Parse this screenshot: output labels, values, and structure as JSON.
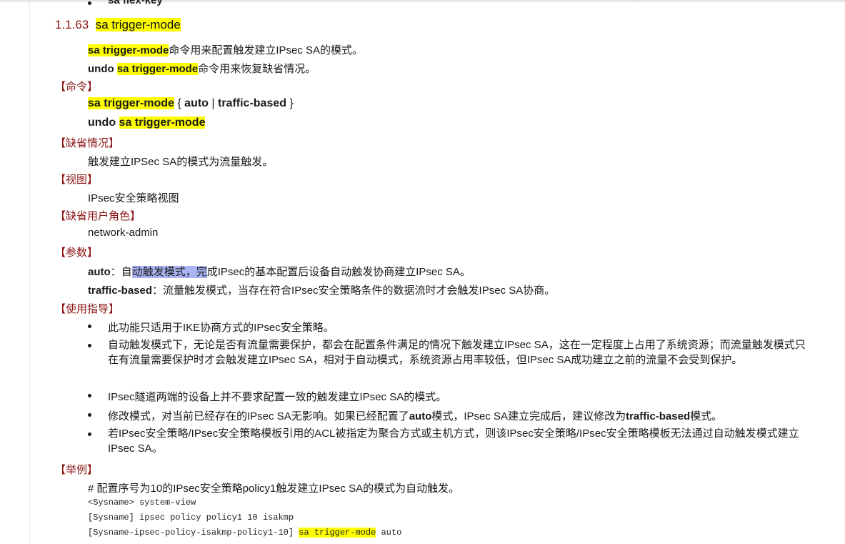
{
  "prev_item": {
    "label": "sa flex-key"
  },
  "heading": {
    "number": "1.1.63",
    "title": "sa trigger-mode"
  },
  "intro": {
    "line1_cmd": "sa trigger-mode",
    "line1_text": "命令用来配置触发建立IPsec SA的模式。",
    "line2_undo": "undo",
    "line2_cmd": "sa trigger-mode",
    "line2_text": "命令用来恢复缺省情况。"
  },
  "sections": {
    "command": "【命令】",
    "default": "【缺省情况】",
    "view": "【视图】",
    "role": "【缺省用户角色】",
    "params": "【参数】",
    "usage": "【使用指导】",
    "example": "【举例】"
  },
  "command": {
    "cmd": "sa trigger-mode",
    "open_brace": " { ",
    "auto": "auto",
    "pipe": " | ",
    "traffic": "traffic-based",
    "close_brace": " }",
    "undo": "undo",
    "undo_cmd": "sa trigger-mode"
  },
  "default_text": "触发建立IPSec SA的模式为流量触发。",
  "view_text": "IPsec安全策略视图",
  "role_text": "network-admin",
  "params": {
    "auto_name": "auto",
    "auto_sep": "：自",
    "auto_selected": "动触发模式，完",
    "auto_rest": "成IPsec的基本配置后设备自动触发协商建立IPsec SA。",
    "traffic_name": "traffic-based",
    "traffic_text": "：流量触发模式，当存在符合IPsec安全策略条件的数据流时才会触发IPsec SA协商。"
  },
  "usage": {
    "b1": "此功能只适用于IKE协商方式的IPsec安全策略。",
    "b2": "自动触发模式下，无论是否有流量需要保护，都会在配置条件满足的情况下触发建立IPsec SA，这在一定程度上占用了系统资源；而流量触发模式只在有流量需要保护时才会触发建立IPsec SA，相对于自动模式，系统资源占用率较低，但IPsec SA成功建立之前的流量不会受到保护。",
    "b3": "IPsec隧道两端的设备上并不要求配置一致的触发建立IPsec SA的模式。",
    "b4_a": "修改模式，对当前已经存在的IPsec SA无影响。如果已经配置了",
    "b4_auto": "auto",
    "b4_b": "模式，IPsec SA建立完成后，建议修改为",
    "b4_traffic": "traffic-based",
    "b4_c": "模式。",
    "b5": "若IPsec安全策略/IPsec安全策略模板引用的ACL被指定为聚合方式或主机方式，则该IPsec安全策略/IPsec安全策略模板无法通过自动触发模式建立IPsec SA。"
  },
  "example": {
    "desc": "# 配置序号为10的IPsec安全策略policy1触发建立IPsec SA的模式为自动触发。",
    "code1": "<Sysname> system-view",
    "code2": "[Sysname] ipsec policy policy1 10 isakmp",
    "code3_prefix": "[Sysname-ipsec-policy-isakmp-policy1-10] ",
    "code3_cmd": "sa trigger-mode",
    "code3_suffix": " auto"
  },
  "colors": {
    "highlight": "#ffff00",
    "selection": "#aab4f2",
    "section": "#8b1414"
  }
}
